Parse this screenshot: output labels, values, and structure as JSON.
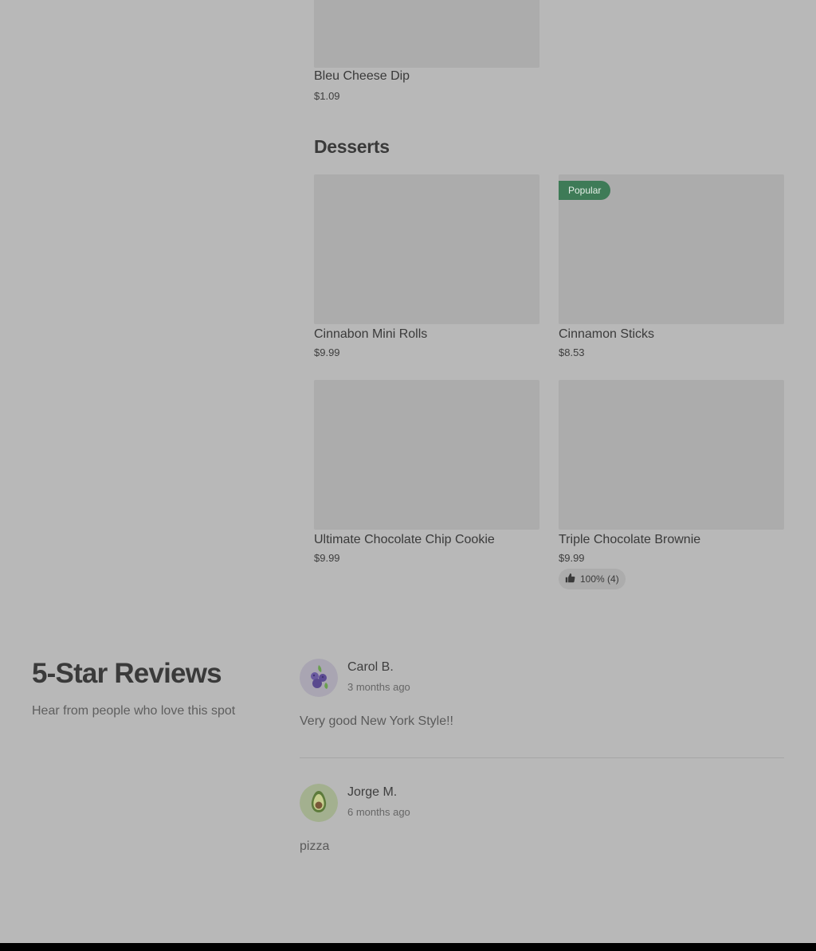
{
  "menu": {
    "top_item": {
      "title": "Bleu Cheese Dip",
      "price": "$1.09"
    },
    "sections": [
      {
        "title": "Desserts",
        "items": [
          {
            "title": "Cinnabon Mini Rolls",
            "price": "$9.99"
          },
          {
            "title": "Cinnamon Sticks",
            "price": "$8.53",
            "badge": "Popular"
          },
          {
            "title": "Ultimate Chocolate Chip Cookie",
            "price": "$9.99"
          },
          {
            "title": "Triple Chocolate Brownie",
            "price": "$9.99",
            "rating": "100% (4)"
          }
        ]
      }
    ]
  },
  "reviews": {
    "title": "5-Star Reviews",
    "subtitle": "Hear from people who love this spot",
    "items": [
      {
        "name": "Carol B.",
        "date": "3 months ago",
        "text": "Very good New York Style!!",
        "avatar_icon": "blueberries-icon"
      },
      {
        "name": "Jorge M.",
        "date": "6 months ago",
        "text": "pizza",
        "avatar_icon": "avocado-icon"
      }
    ]
  },
  "colors": {
    "overlay_background": "#b8b8b8",
    "image_placeholder": "#acacac",
    "popular_badge": "#3e7b57"
  }
}
